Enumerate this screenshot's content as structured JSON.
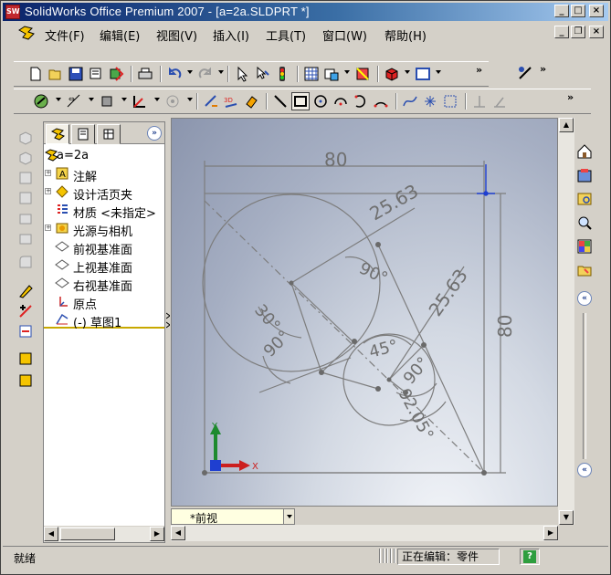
{
  "window": {
    "title": "SolidWorks Office Premium 2007 - [a=2a.SLDPRT *]",
    "app_badge": "SW",
    "controls": {
      "minimize": "_",
      "maximize": "□",
      "close": "×"
    }
  },
  "menu": {
    "items": [
      {
        "label": "文件(F)"
      },
      {
        "label": "编辑(E)"
      },
      {
        "label": "视图(V)"
      },
      {
        "label": "插入(I)"
      },
      {
        "label": "工具(T)"
      },
      {
        "label": "窗口(W)"
      },
      {
        "label": "帮助(H)"
      }
    ],
    "doc_controls": {
      "minimize": "_",
      "restore": "❐",
      "close": "×"
    }
  },
  "toolbar_top": {
    "icons": [
      "new-icon",
      "open-icon",
      "save-icon",
      "print-preview-icon",
      "rebuild-icon",
      "print-icon",
      "undo-icon",
      "redo-icon",
      "select-icon",
      "select-other-icon",
      "traffic-light-icon",
      "grid-icon",
      "options-icon",
      "render-icon",
      "color-icon",
      "view-icon"
    ],
    "overflow": "»"
  },
  "toolbar_sketch": {
    "icons": [
      "sketch-icon",
      "smart-dimension-icon",
      "relations-icon",
      "axis-icon",
      "circle-pattern-icon",
      "sketch-3d-icon",
      "sketch-3d-plane-icon",
      "eraser-icon",
      "line-icon",
      "rectangle-icon",
      "circle-icon",
      "centerpoint-arc-icon",
      "tangent-arc-icon",
      "three-point-arc-icon",
      "spline-icon",
      "point-icon",
      "hatch-icon",
      "centerline-icon",
      "trim-icon"
    ],
    "overflow": "»"
  },
  "feature_manager": {
    "collapse": "»",
    "root": {
      "label": "a=2a"
    },
    "items": [
      {
        "label": "注解",
        "icon": "annotations-icon",
        "expandable": true
      },
      {
        "label": "设计活页夹",
        "icon": "design-binder-icon",
        "expandable": true
      },
      {
        "label": "材质 <未指定>",
        "icon": "material-icon",
        "expandable": false
      },
      {
        "label": "光源与相机",
        "icon": "lights-cameras-icon",
        "expandable": true
      },
      {
        "label": "前视基准面",
        "icon": "plane-icon",
        "expandable": false
      },
      {
        "label": "上视基准面",
        "icon": "plane-icon",
        "expandable": false
      },
      {
        "label": "右视基准面",
        "icon": "plane-icon",
        "expandable": false
      },
      {
        "label": "原点",
        "icon": "origin-icon",
        "expandable": false
      },
      {
        "label": "(-) 草图1",
        "icon": "sketch-icon",
        "expandable": false
      }
    ]
  },
  "graphics": {
    "view_name": "*前视",
    "dimensions": {
      "top_width": "80",
      "right_height": "80",
      "large_circle_radius": "25.63",
      "small_circle_radius": "25.63",
      "angle_1": "90°",
      "angle_2": "30°",
      "angle_3": "90°",
      "angle_4": "45°",
      "angle_5": "90°",
      "angle_6": "92.05°"
    },
    "triad": {
      "y_label": "Y",
      "x_label": "X"
    }
  },
  "task_pane": {
    "icons": [
      "home-icon",
      "library-icon",
      "explorer-icon",
      "search-icon",
      "palette-icon",
      "folder-icon"
    ],
    "collapse": "«"
  },
  "status_bar": {
    "left": "就绪",
    "editing": "正在编辑：零件",
    "help": "?"
  },
  "colors": {
    "title_gradient_start": "#0a246a",
    "title_gradient_end": "#a6caf0",
    "sketch_line": "#7d7d7d",
    "selected_rect": "#000000",
    "triad_y": "#1e8a2e",
    "triad_x": "#cc1f1f",
    "view_tab": "#ffffe1"
  }
}
